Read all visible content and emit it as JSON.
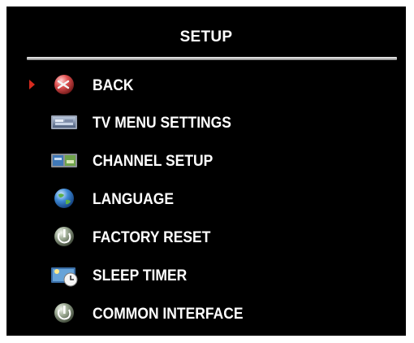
{
  "header": {
    "title": "SETUP"
  },
  "menu": {
    "items": [
      {
        "label": "BACK",
        "icon": "back-icon",
        "selected": true
      },
      {
        "label": "TV MENU SETTINGS",
        "icon": "tv-menu-settings-icon",
        "selected": false
      },
      {
        "label": "CHANNEL SETUP",
        "icon": "channel-setup-icon",
        "selected": false
      },
      {
        "label": "LANGUAGE",
        "icon": "globe-icon",
        "selected": false
      },
      {
        "label": "FACTORY RESET",
        "icon": "factory-reset-icon",
        "selected": false
      },
      {
        "label": "SLEEP TIMER",
        "icon": "sleep-timer-icon",
        "selected": false
      },
      {
        "label": "COMMON INTERFACE",
        "icon": "common-interface-icon",
        "selected": false
      }
    ]
  },
  "colors": {
    "background": "#000000",
    "text": "#ffffff",
    "cursor": "#d62a1e"
  }
}
